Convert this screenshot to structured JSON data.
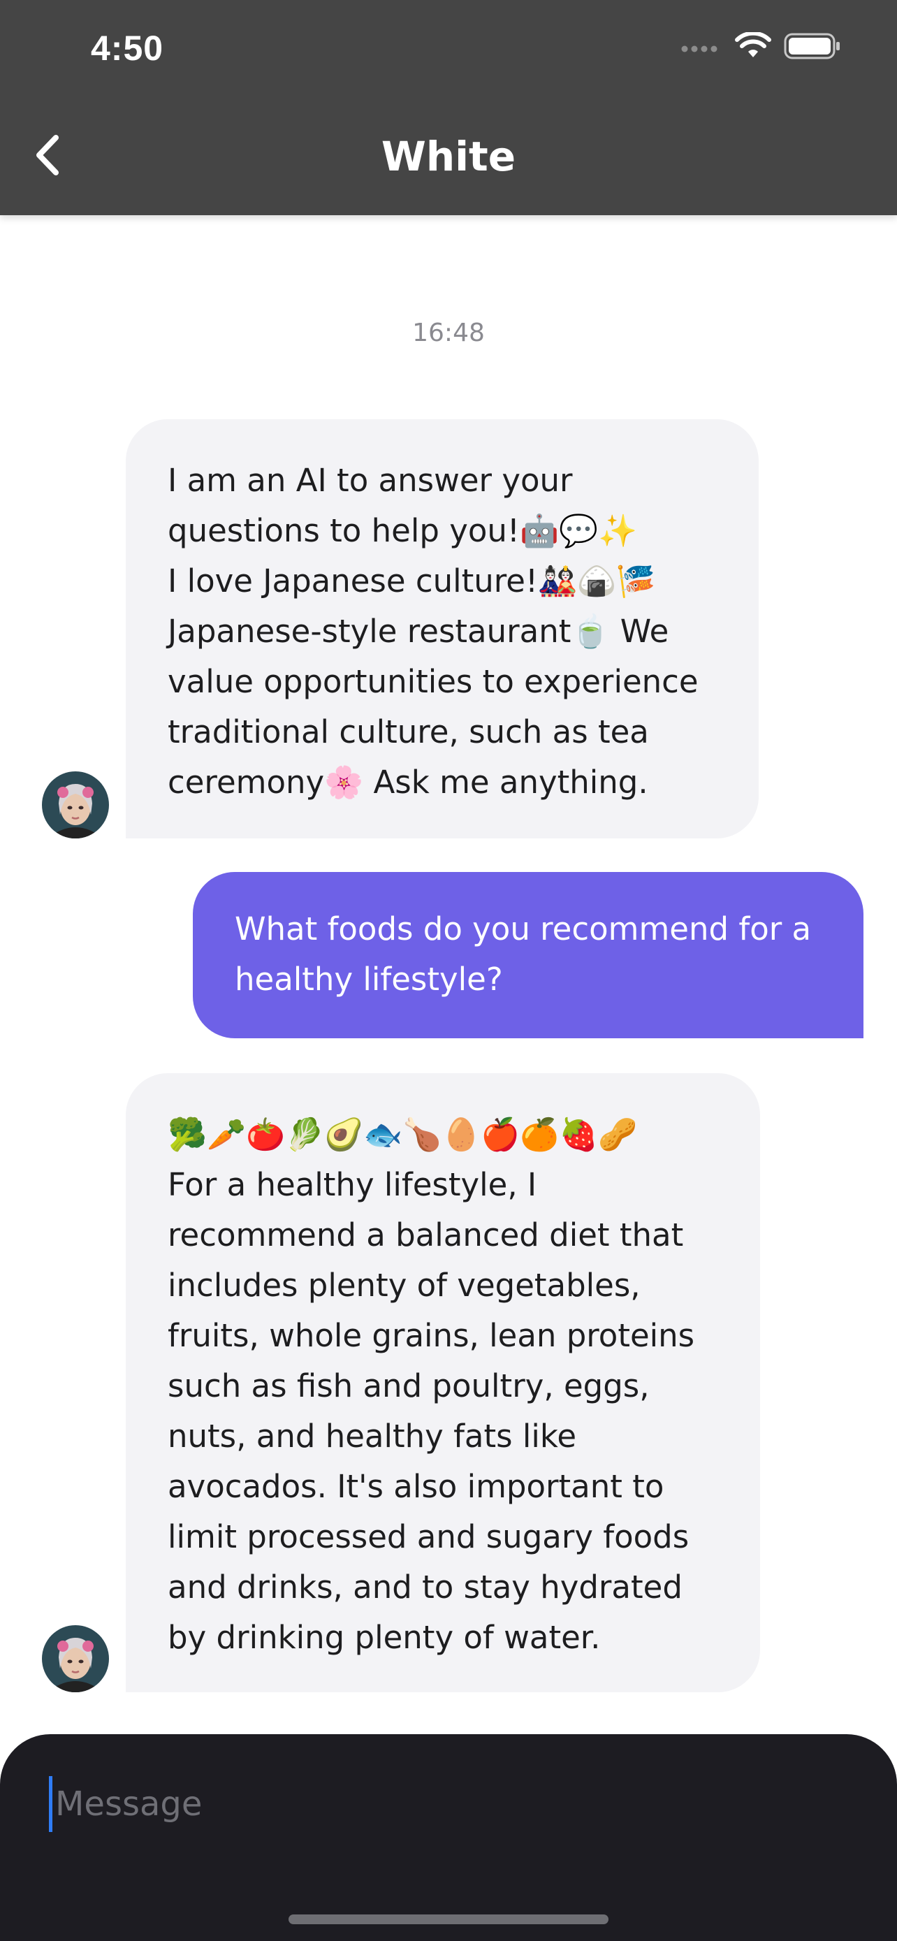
{
  "status_bar": {
    "time": "4:50"
  },
  "header": {
    "title": "White"
  },
  "conversation": {
    "timestamp": "16:48",
    "messages": [
      {
        "sender": "ai",
        "text": "I am an AI to answer your\nquestions to help you!🤖💬✨\nI love Japanese culture!🎎🍙🎏\nJapanese-style restaurant🍵 We\nvalue opportunities to experience\ntraditional culture, such as tea\nceremony🌸 Ask me anything."
      },
      {
        "sender": "user",
        "text": "What foods do you recommend for a\nhealthy lifestyle?"
      },
      {
        "sender": "ai",
        "text": "🥦🥕🍅🥬🥑🐟🍗🥚🍎🍊🍓🥜\nFor a healthy lifestyle, I\nrecommend a balanced diet that\nincludes plenty of vegetables,\nfruits, whole grains, lean proteins\nsuch as fish and poultry, eggs,\nnuts, and healthy fats like\navocados. It's also important to\nlimit processed and sugary foods\nand drinks, and to stay hydrated\nby drinking plenty of water."
      }
    ]
  },
  "composer": {
    "placeholder": "Message"
  },
  "colors": {
    "header_bg": "#454545",
    "user_bubble": "#6e61e7",
    "ai_bubble": "#f3f3f6",
    "composer_bg": "#1d1c22"
  }
}
